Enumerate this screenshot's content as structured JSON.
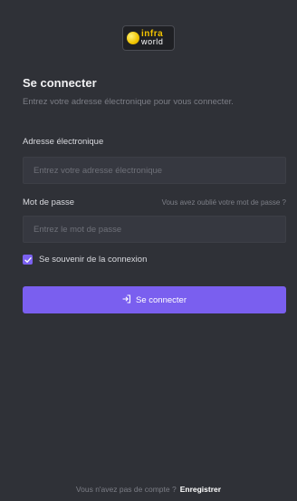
{
  "brand": {
    "logo_top": "infra",
    "logo_bottom": "world",
    "accent_color": "#7a5fef",
    "logo_color": "#f2c300"
  },
  "login": {
    "title": "Se connecter",
    "subtitle": "Entrez votre adresse électronique pour vous connecter.",
    "email_label": "Adresse électronique",
    "email_placeholder": "Entrez votre adresse électronique",
    "email_value": "",
    "password_label": "Mot de passe",
    "forgot_link": "Vous avez oublié votre mot de passe ?",
    "password_placeholder": "Entrez le mot de passe",
    "password_value": "",
    "remember_label": "Se souvenir de la connexion",
    "remember_checked": true,
    "submit_label": "Se connecter",
    "submit_icon": "login-icon"
  },
  "footer": {
    "prompt": "Vous n'avez pas de compte ?",
    "register_link": "Enregistrer"
  }
}
